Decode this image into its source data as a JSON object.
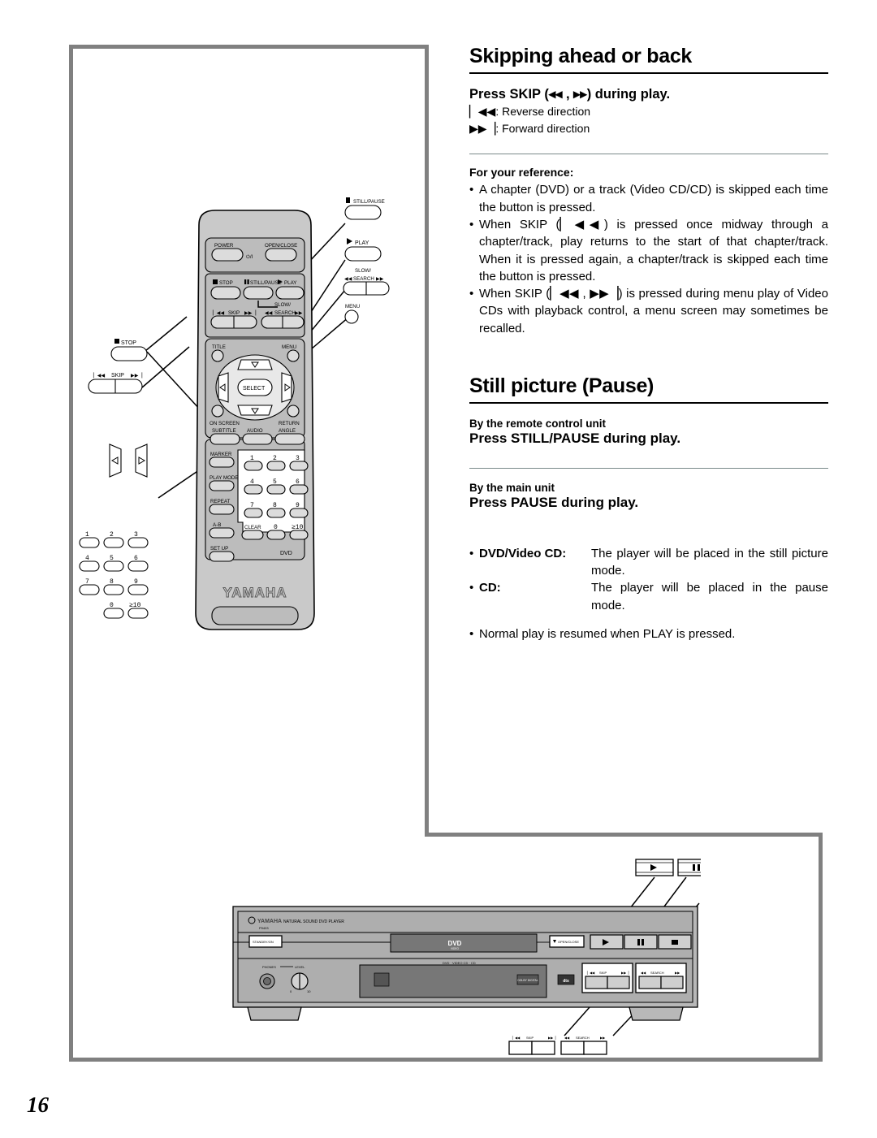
{
  "page": {
    "number": "16"
  },
  "sections": [
    {
      "id": "skipping",
      "title": "Skipping ahead or back",
      "lead": "Press SKIP (◂◂ , ▸▸) during play.",
      "lead_display": "Press SKIP (",
      "directions": [
        {
          "icon": "▏◀◀",
          "text": ": Reverse direction"
        },
        {
          "icon": "▶▶▕",
          "text": ": Forward direction"
        }
      ],
      "reference_heading": "For your reference:",
      "bullets": [
        "A chapter (DVD) or a track (Video CD/CD) is skipped each time the button is pressed.",
        "When SKIP (▏◀◀) is pressed once midway through a chapter/track, play returns to the start of that chapter/track. When it is pressed again, a chapter/track is skipped each time the button is pressed.",
        "When SKIP (▏◀◀ , ▶▶▕) is pressed during menu play of Video CDs with playback control, a menu screen may sometimes be recalled."
      ]
    },
    {
      "id": "still-picture",
      "title": "Still picture (Pause)",
      "remote_label": "By the remote control unit",
      "remote_instruction": "Press STILL/PAUSE during play.",
      "main_label": "By the main unit",
      "main_instruction": "Press PAUSE during play.",
      "definitions": [
        {
          "term": "DVD/Video CD:",
          "desc": "The player will be placed in the still picture mode."
        },
        {
          "term": "CD:",
          "desc": "The player will be placed in the pause mode."
        }
      ],
      "note": "Normal play is resumed when PLAY is pressed."
    }
  ],
  "remote": {
    "brand": "YAMAHA",
    "mode_label": "DVD",
    "buttons": {
      "power": "POWER",
      "power_symbol": "⏻/I",
      "open_close": "OPEN/CLOSE",
      "stop": "STOP",
      "still_pause": "STILL/PAUSE",
      "play": "PLAY",
      "skip": "SKIP",
      "slow": "SLOW/",
      "search": "SEARCH",
      "title": "TITLE",
      "menu": "MENU",
      "select": "SELECT",
      "on_screen": "ON SCREEN",
      "return": "RETURN",
      "subtitle": "SUBTITLE",
      "audio": "AUDIO",
      "angle": "ANGLE",
      "marker": "MARKER",
      "play_mode": "PLAY MODE",
      "repeat": "REPEAT",
      "ab": "A-B",
      "clear": "CLEAR",
      "set_up": "SET UP",
      "skip_left": "▏◀◀",
      "skip_right": "▶▶▕",
      "search_left": "◀◀",
      "search_right": "▶▶",
      "stop_glyph": "■",
      "pause_glyph": "❘❘",
      "play_glyph": "▶"
    },
    "keypad": [
      "1",
      "2",
      "3",
      "4",
      "5",
      "6",
      "7",
      "8",
      "9",
      "0",
      "≥10"
    ],
    "callouts": [
      {
        "id": "callout-still-pause",
        "label": "STILL/PAUSE",
        "glyph": "❘❘"
      },
      {
        "id": "callout-play",
        "label": "PLAY",
        "glyph": "▶"
      },
      {
        "id": "callout-slow-search",
        "label": "SEARCH",
        "top": "SLOW/",
        "left": "◀◀",
        "right": "▶▶"
      },
      {
        "id": "callout-menu",
        "label": "MENU"
      },
      {
        "id": "callout-stop",
        "label": "STOP",
        "glyph": "■"
      },
      {
        "id": "callout-skip",
        "label": "SKIP",
        "left": "▏◀◀",
        "right": "▶▶▕"
      },
      {
        "id": "callout-cursor",
        "label": ""
      },
      {
        "id": "callout-keypad",
        "label": ""
      }
    ]
  },
  "front_panel": {
    "brand": "YAMAHA",
    "model_text": "NATURAL SOUND DVD PLAYER",
    "sub_brand": "P9403",
    "standby": "STANDBY/ON",
    "open_close": "OPEN/CLOSE",
    "disc_types": "DVD · VIDEO CD · CD",
    "disc_logo": "DVD",
    "disc_logo_sub": "VIDEO",
    "phones": "PHONES",
    "level": "LEVEL",
    "dolby": "DOLBY DIGITAL",
    "dts": "dts",
    "skip": "SKIP",
    "search": "SEARCH",
    "skip_left": "▏◀◀",
    "skip_right": "▶▶▕",
    "search_left": "◀◀",
    "search_right": "▶▶",
    "play_glyph": "▶",
    "pause_glyph": "❘❘",
    "stop_glyph": "■",
    "callouts": [
      {
        "id": "panel-callout-play",
        "glyph": "▶"
      },
      {
        "id": "panel-callout-pause",
        "glyph": "❘❘"
      },
      {
        "id": "panel-callout-stop",
        "glyph": "■"
      },
      {
        "id": "panel-callout-skip",
        "label": "SKIP"
      },
      {
        "id": "panel-callout-search",
        "label": "SEARCH"
      }
    ]
  }
}
